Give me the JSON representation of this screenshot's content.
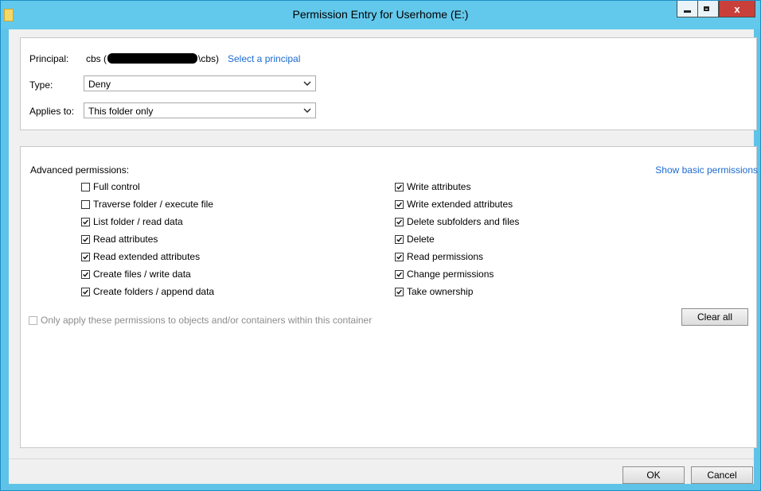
{
  "window": {
    "title": "Permission Entry for Userhome (E:)",
    "close_glyph": "x"
  },
  "principal": {
    "label": "Principal:",
    "name_prefix": "cbs (",
    "name_suffix": "\\cbs)",
    "select_link": "Select a principal"
  },
  "type": {
    "label": "Type:",
    "value": "Deny"
  },
  "applies_to": {
    "label": "Applies to:",
    "value": "This folder only"
  },
  "advanced": {
    "heading": "Advanced permissions:",
    "show_basic_link": "Show basic permissions",
    "left": [
      {
        "label": "Full control",
        "checked": false
      },
      {
        "label": "Traverse folder / execute file",
        "checked": false
      },
      {
        "label": "List folder / read data",
        "checked": true
      },
      {
        "label": "Read attributes",
        "checked": true
      },
      {
        "label": "Read extended attributes",
        "checked": true
      },
      {
        "label": "Create files / write data",
        "checked": true
      },
      {
        "label": "Create folders / append data",
        "checked": true
      }
    ],
    "right": [
      {
        "label": "Write attributes",
        "checked": true
      },
      {
        "label": "Write extended attributes",
        "checked": true
      },
      {
        "label": "Delete subfolders and files",
        "checked": true
      },
      {
        "label": "Delete",
        "checked": true
      },
      {
        "label": "Read permissions",
        "checked": true
      },
      {
        "label": "Change permissions",
        "checked": true
      },
      {
        "label": "Take ownership",
        "checked": true
      }
    ],
    "only_apply": {
      "label": "Only apply these permissions to objects and/or containers within this container",
      "checked": false,
      "disabled": true
    },
    "clear_all": "Clear all"
  },
  "footer": {
    "ok": "OK",
    "cancel": "Cancel"
  },
  "colors": {
    "titlebar": "#63c9ec",
    "link": "#1b6ad0",
    "close": "#c9403a"
  }
}
